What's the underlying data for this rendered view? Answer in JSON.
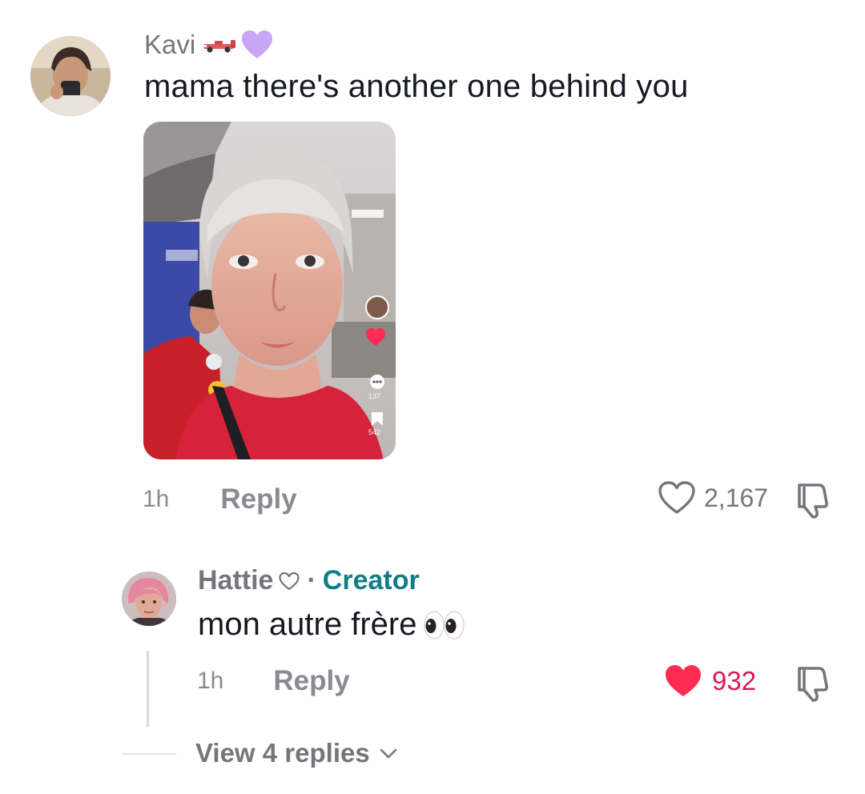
{
  "comment": {
    "username": "Kavi",
    "badges": [
      "race-car-emoji",
      "purple-heart-emoji"
    ],
    "text": "mama there's another one behind you",
    "thumbnail": {
      "likes_label": "137",
      "saves_label": "542"
    },
    "time": "1h",
    "reply_label": "Reply",
    "like_count": "2,167",
    "liked": false
  },
  "reply": {
    "username": "Hattie",
    "username_suffix_icon": "heart-outline",
    "separator": "·",
    "role_label": "Creator",
    "text": "mon autre frère",
    "text_emoji": "eyes-emoji",
    "time": "1h",
    "reply_label": "Reply",
    "like_count": "932",
    "liked": true,
    "like_color": "#fe2c55"
  },
  "view_replies": {
    "label": "View 4 replies",
    "icon": "chevron-down-icon"
  },
  "colors": {
    "muted": "#75757c",
    "creator": "#127c87",
    "text": "#161823"
  }
}
